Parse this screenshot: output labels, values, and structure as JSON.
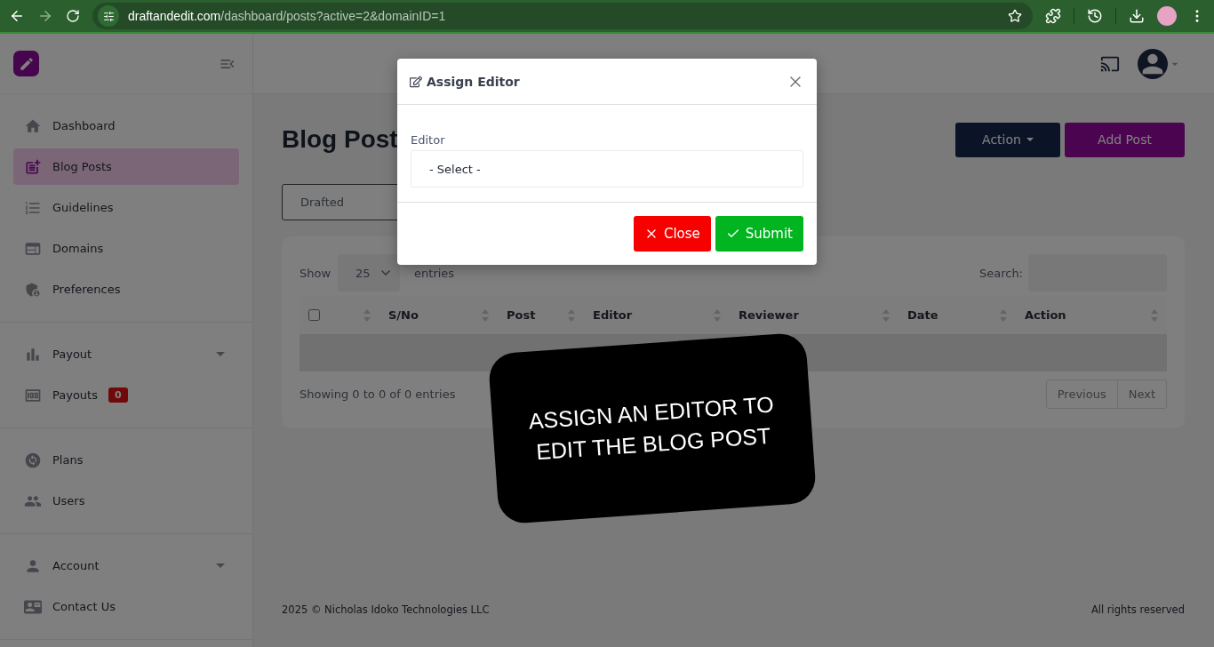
{
  "browser": {
    "url_host": "draftandedit.com",
    "url_path": "/dashboard/posts?active=2&domainID=1",
    "forward_disabled": true
  },
  "sidebar": {
    "groups": [
      {
        "items": [
          {
            "kind": "link",
            "label": "Dashboard",
            "selected": false
          },
          {
            "kind": "link",
            "label": "Blog Posts",
            "selected": true
          },
          {
            "kind": "link",
            "label": "Guidelines",
            "selected": false
          },
          {
            "kind": "link",
            "label": "Domains",
            "selected": false
          },
          {
            "kind": "link",
            "label": "Preferences",
            "selected": false
          }
        ]
      },
      {
        "items": [
          {
            "kind": "menu",
            "label": "Payout",
            "selected": false
          },
          {
            "kind": "link",
            "label": "Payouts",
            "selected": false,
            "badge": "0"
          }
        ]
      },
      {
        "items": [
          {
            "kind": "link",
            "label": "Plans",
            "selected": false
          },
          {
            "kind": "link",
            "label": "Users",
            "selected": false
          }
        ]
      },
      {
        "items": [
          {
            "kind": "menu",
            "label": "Account",
            "selected": false
          },
          {
            "kind": "link",
            "label": "Contact Us",
            "selected": false
          }
        ]
      }
    ]
  },
  "page": {
    "title": "Blog Post",
    "action_button": "Action",
    "add_button": "Add Post",
    "status_filter": "Drafted"
  },
  "table": {
    "show_label": "Show",
    "page_size": "25",
    "entries_label": "entries",
    "search_label": "Search:",
    "columns": [
      {
        "kind": "checkbox",
        "checked": false
      },
      {
        "kind": "text",
        "label": "S/No"
      },
      {
        "kind": "text",
        "label": "Post"
      },
      {
        "kind": "text",
        "label": "Editor"
      },
      {
        "kind": "text",
        "label": "Reviewer"
      },
      {
        "kind": "text",
        "label": "Date"
      },
      {
        "kind": "text",
        "label": "Action"
      }
    ],
    "info": "Showing 0 to 0 of 0 entries",
    "pagination": [
      "Previous",
      "Next"
    ]
  },
  "footer": {
    "copyright": "2025 © Nicholas Idoko Technologies LLC",
    "rights": "All rights reserved"
  },
  "modal": {
    "title": "Assign Editor",
    "field_label": "Editor",
    "select_value": "- Select -",
    "buttons": [
      {
        "kind": "close",
        "label": "Close"
      },
      {
        "kind": "submit",
        "label": "Submit"
      }
    ]
  },
  "callout": {
    "text": "ASSIGN AN EDITOR TO EDIT THE BLOG POST"
  }
}
